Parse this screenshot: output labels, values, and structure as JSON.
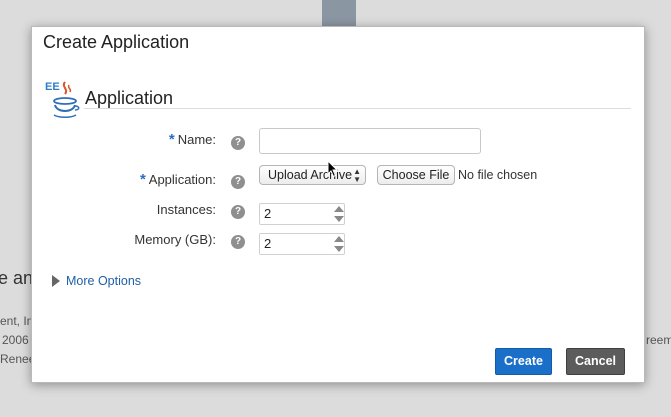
{
  "background": {
    "line1": "e and",
    "line2": "ent, In",
    "line3": "2006",
    "line4": "Renee",
    "right_line": "reeme"
  },
  "dialog": {
    "title": "Create Application",
    "section": {
      "icon_text": "EE",
      "title": "Application"
    },
    "fields": {
      "name": {
        "required_mark": "*",
        "label": "Name:",
        "value": "",
        "help": "?"
      },
      "application": {
        "required_mark": "*",
        "label": "Application:",
        "help": "?",
        "select_value": "Upload Archive",
        "file_button": "Choose File",
        "file_status": "No file chosen"
      },
      "instances": {
        "label": "Instances:",
        "value": "2",
        "help": "?"
      },
      "memory": {
        "label": "Memory (GB):",
        "value": "2",
        "help": "?"
      }
    },
    "more_options": "More Options",
    "buttons": {
      "create": "Create",
      "cancel": "Cancel"
    }
  },
  "colors": {
    "primary": "#1a6fc9",
    "secondary": "#5c5c5c",
    "link": "#1f5fa8",
    "required": "#2b6cc4"
  }
}
